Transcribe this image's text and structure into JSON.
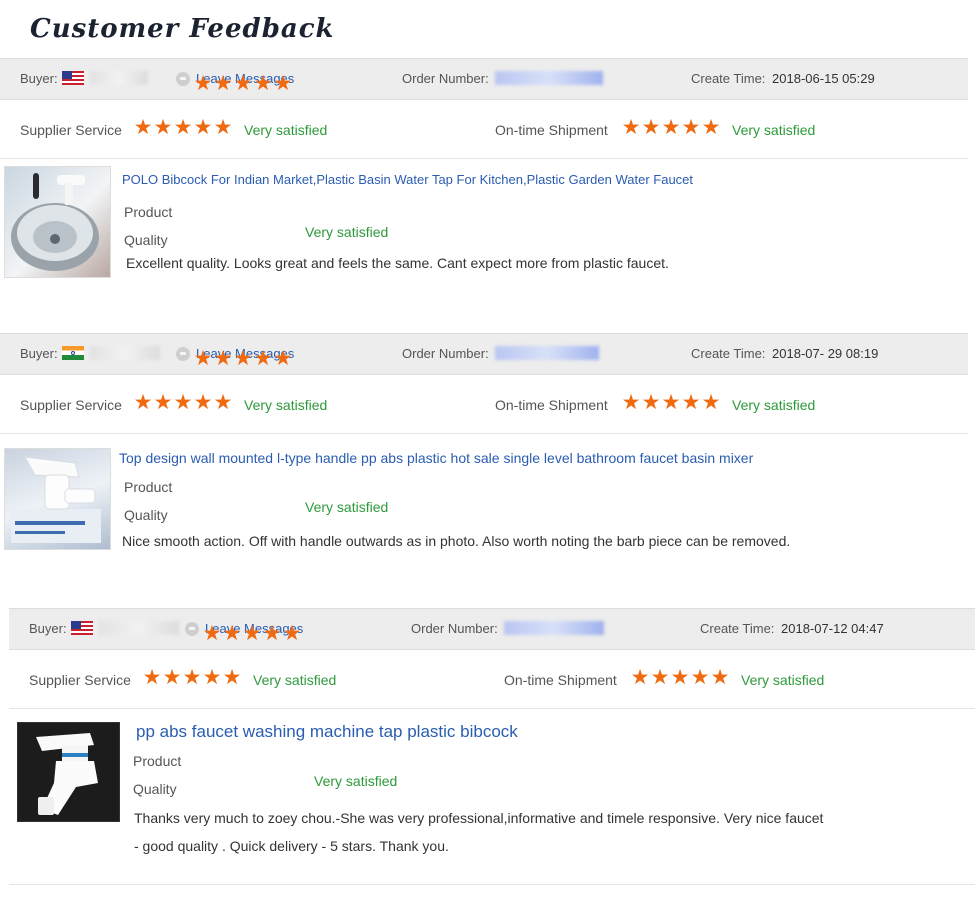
{
  "page": {
    "title": "Customer Feedback"
  },
  "labels": {
    "buyer": "Buyer:",
    "leave_messages": "Leave Messages",
    "order_number": "Order Number:",
    "create_time": "Create Time:",
    "supplier_service": "Supplier Service",
    "on_time_shipment": "On-time Shipment",
    "product": "Product",
    "quality": "Quality",
    "star": "★"
  },
  "reviews": [
    {
      "buyer_flag": "us-flag-icon",
      "create_time": "2018-06-15 05:29",
      "supplier_service": {
        "stars": 5,
        "text": "Very satisfied"
      },
      "on_time_shipment": {
        "stars": 5,
        "text": "Very satisfied"
      },
      "product_title": "POLO Bibcock For Indian Market,Plastic Basin Water Tap For Kitchen,Plastic Garden Water Faucet",
      "product_quality": {
        "stars": 5,
        "text": "Very satisfied"
      },
      "comment": "Excellent quality. Looks great and feels the same. Cant expect more from plastic faucet."
    },
    {
      "buyer_flag": "india-flag-icon",
      "create_time": "2018-07- 29 08:19",
      "supplier_service": {
        "stars": 5,
        "text": "Very satisfied"
      },
      "on_time_shipment": {
        "stars": 5,
        "text": "Very satisfied"
      },
      "product_title": "Top design wall mounted l-type handle pp abs plastic hot sale single level bathroom faucet basin mixer",
      "product_quality": {
        "stars": 5,
        "text": "Very satisfied"
      },
      "comment": "Nice smooth action. Off with handle outwards as in photo. Also worth noting the barb piece can be removed."
    },
    {
      "buyer_flag": "us-flag-icon",
      "create_time": "2018-07-12 04:47",
      "supplier_service": {
        "stars": 5,
        "text": "Very satisfied"
      },
      "on_time_shipment": {
        "stars": 5,
        "text": "Very satisfied"
      },
      "product_title": "pp abs faucet washing machine tap plastic bibcock",
      "product_quality": {
        "stars": 5,
        "text": "Very satisfied"
      },
      "comment_line1": "Thanks very much to zoey chou.-She was very professional,informative and timele responsive. Very nice faucet",
      "comment_line2": "- good quality . Quick delivery - 5 stars. Thank you."
    }
  ]
}
